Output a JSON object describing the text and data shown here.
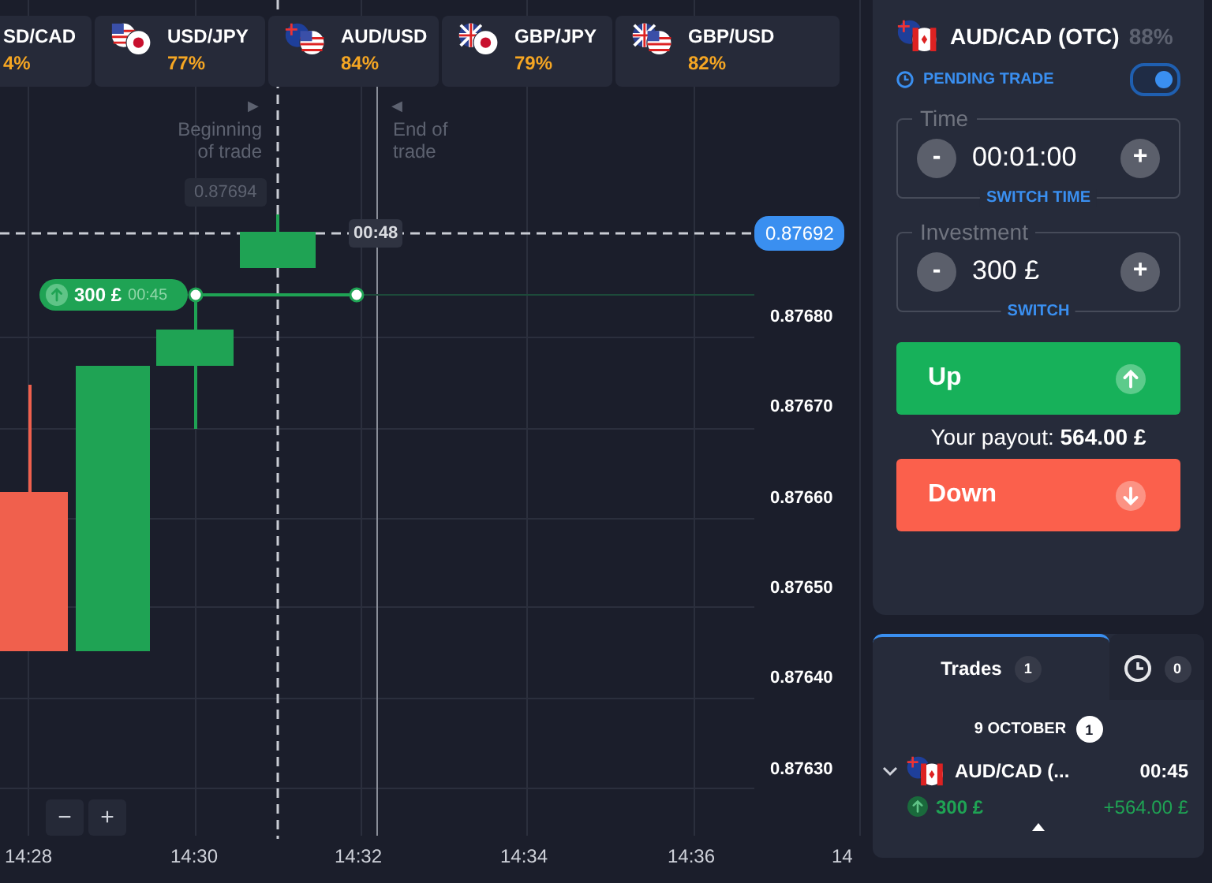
{
  "asset_tabs": [
    {
      "pair": "SD/CAD",
      "payout": "4%"
    },
    {
      "pair": "USD/JPY",
      "payout": "77%"
    },
    {
      "pair": "AUD/USD",
      "payout": "84%"
    },
    {
      "pair": "GBP/JPY",
      "payout": "79%"
    },
    {
      "pair": "GBP/USD",
      "payout": "82%"
    }
  ],
  "chart": {
    "start_label": "Beginning of trade",
    "end_label": "End of trade",
    "start_arrow": "▶",
    "end_arrow": "◀",
    "open_price": "0.87694",
    "current_price": "0.87692",
    "timer": "00:48",
    "trade_pill": {
      "amount": "300 £",
      "time": "00:45"
    },
    "price_labels": [
      "0.87680",
      "0.87670",
      "0.87660",
      "0.87650",
      "0.87640",
      "0.87630"
    ],
    "time_labels": [
      "14:28",
      "14:30",
      "14:32",
      "14:34",
      "14:36",
      "14"
    ],
    "zoom_buttons": [
      "−",
      "+"
    ]
  },
  "trade_panel": {
    "asset": "AUD/CAD (OTC)",
    "payout": "88%",
    "pending_label": "PENDING TRADE",
    "pending_on": true,
    "fields": [
      {
        "label": "Time",
        "value": "00:01:00",
        "minus": "-",
        "plus": "+",
        "switch": "SWITCH TIME"
      },
      {
        "label": "Investment",
        "value": "300 £",
        "minus": "-",
        "plus": "+",
        "switch": "SWITCH"
      }
    ],
    "up_button": "Up",
    "payout_text": "Your payout: **564.00 £**",
    "down_button": "Down"
  },
  "trades": {
    "tabs": [
      {
        "kind": "text",
        "label": "Trades",
        "count": "1",
        "selected": true
      },
      {
        "kind": "clock",
        "count": "0",
        "selected": false
      }
    ],
    "date": "9 OCTOBER",
    "date_count": "1",
    "rows": [
      {
        "pair": "AUD/CAD (...",
        "time": "00:45",
        "amount": "300 £",
        "profit": "+564.00 £",
        "expanded": false
      }
    ]
  }
}
